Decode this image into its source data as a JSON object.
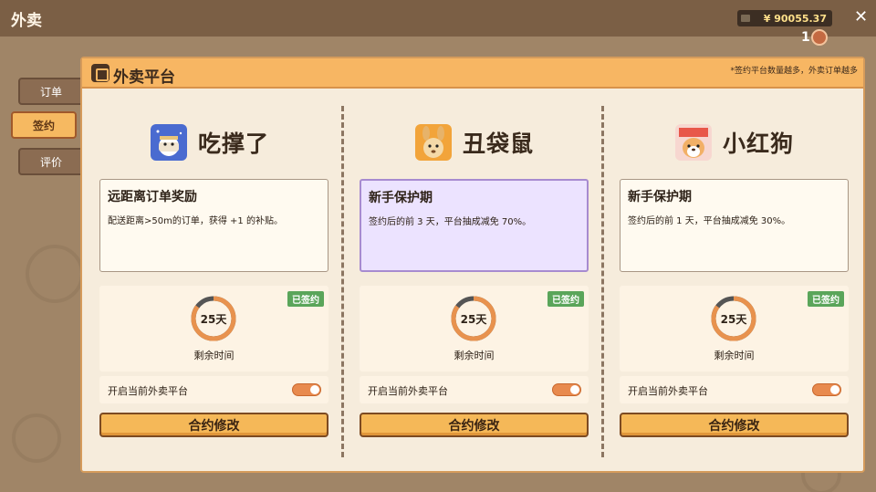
{
  "app": {
    "title": "外卖",
    "close_icon": "close-icon"
  },
  "wallet": {
    "money": "¥ 90055.37",
    "coins": "1"
  },
  "sidebar": {
    "tabs": [
      {
        "label": "订单"
      },
      {
        "label": "签约",
        "active": true
      },
      {
        "label": "评价"
      }
    ]
  },
  "panel": {
    "title": "外卖平台",
    "note": "*签约平台数量越多，外卖订单越多"
  },
  "platforms": [
    {
      "name": "吃撑了",
      "logo": "noodle-bowl-logo",
      "perk_title": "远距离订单奖励",
      "perk_desc": "配送距离>50m的订单，获得 +1 的补贴。",
      "perk_style": "normal",
      "badge": "已签约",
      "days": "25天",
      "remain_label": "剩余时间",
      "remain_fraction": 0.85,
      "toggle_label": "开启当前外卖平台",
      "enabled": true,
      "button": "合约修改"
    },
    {
      "name": "丑袋鼠",
      "logo": "kangaroo-logo",
      "perk_title": "新手保护期",
      "perk_desc": "签约后的前 3 天，平台抽成减免 70%。",
      "perk_style": "purple",
      "badge": "已签约",
      "days": "25天",
      "remain_label": "剩余时间",
      "remain_fraction": 0.85,
      "toggle_label": "开启当前外卖平台",
      "enabled": true,
      "button": "合约修改"
    },
    {
      "name": "小红狗",
      "logo": "dog-logo",
      "perk_title": "新手保护期",
      "perk_desc": "签约后的前 1 天，平台抽成减免 30%。",
      "perk_style": "normal",
      "badge": "已签约",
      "days": "25天",
      "remain_label": "剩余时间",
      "remain_fraction": 0.85,
      "toggle_label": "开启当前外卖平台",
      "enabled": true,
      "button": "合约修改"
    }
  ]
}
